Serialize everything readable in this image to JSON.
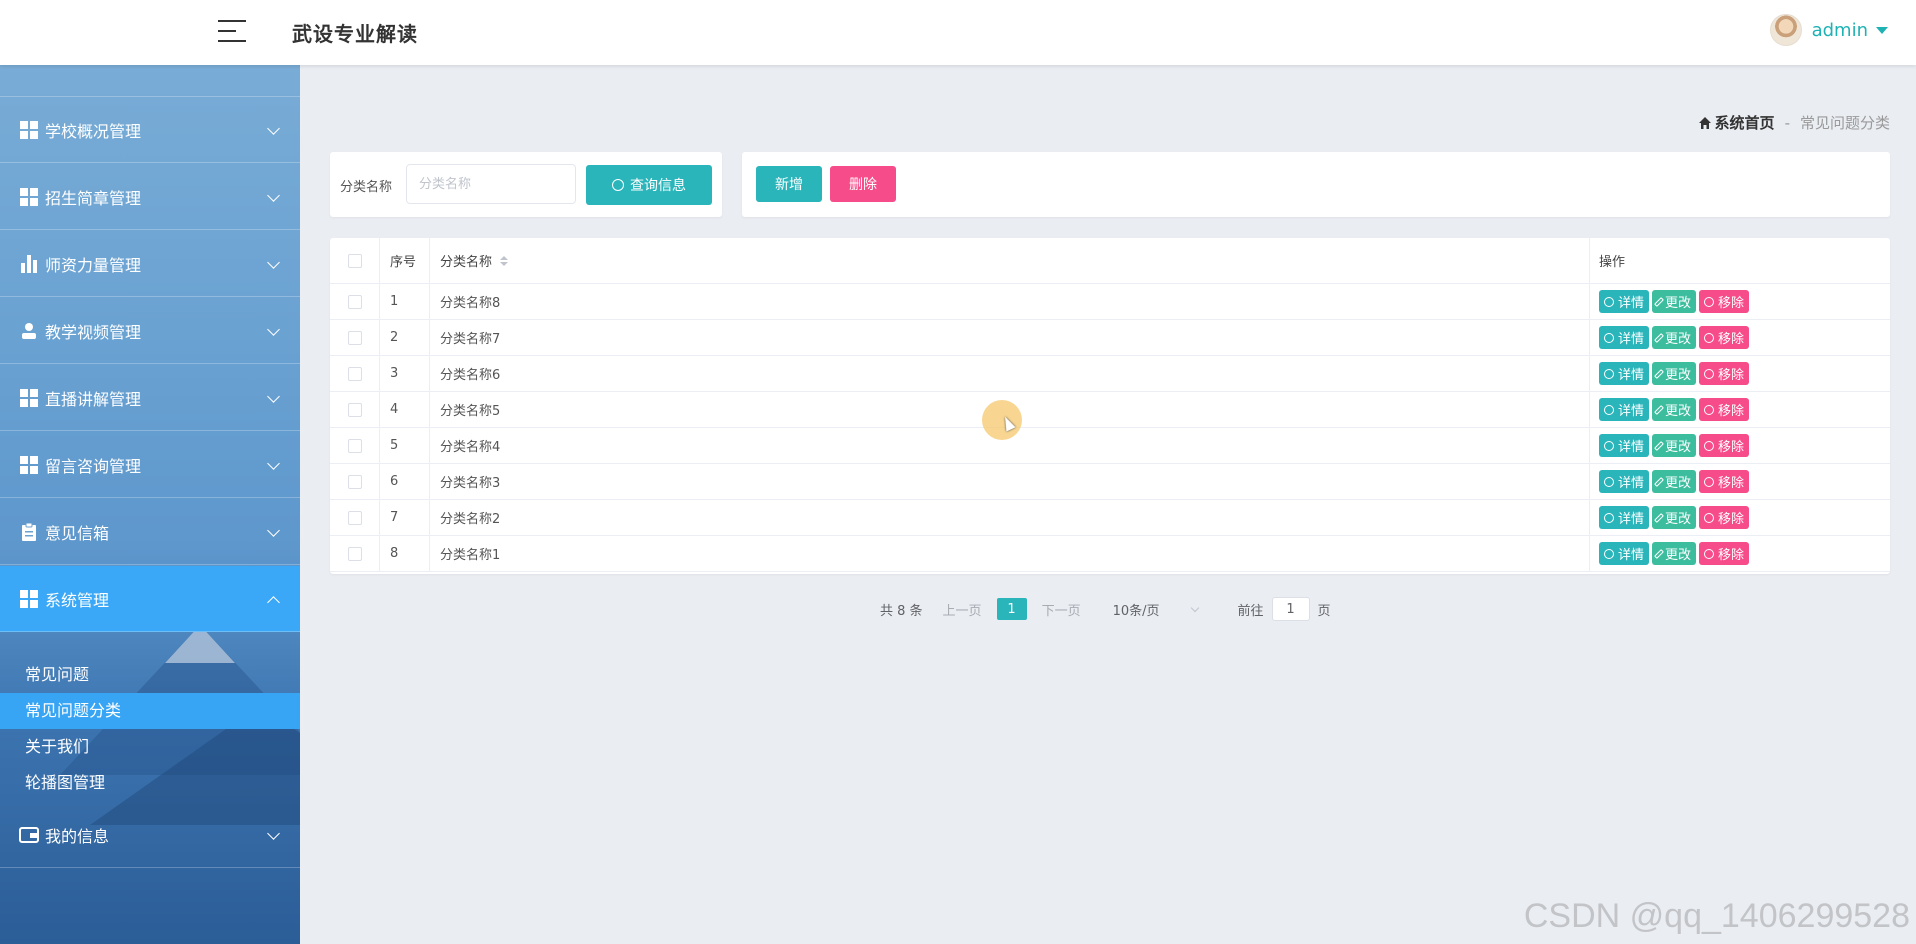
{
  "header": {
    "app_title": "武设专业解读",
    "user_name": "admin",
    "menu_toggle_icon": "hamburger-icon",
    "avatar_icon": "avatar"
  },
  "sidebar": {
    "items": [
      {
        "label": "学校概况管理",
        "icon": "grid-icon"
      },
      {
        "label": "招生简章管理",
        "icon": "grid-icon"
      },
      {
        "label": "师资力量管理",
        "icon": "bar-chart-icon"
      },
      {
        "label": "教学视频管理",
        "icon": "user-icon"
      },
      {
        "label": "直播讲解管理",
        "icon": "grid-icon"
      },
      {
        "label": "留言咨询管理",
        "icon": "grid-icon"
      },
      {
        "label": "意见信箱",
        "icon": "clipboard-icon"
      },
      {
        "label": "系统管理",
        "icon": "grid-icon",
        "expanded": true
      },
      {
        "label": "我的信息",
        "icon": "wallet-icon"
      }
    ],
    "sub_items": [
      "常见问题",
      "常见问题分类",
      "关于我们",
      "轮播图管理"
    ],
    "active_sub_item": "常见问题分类",
    "active_color": "#3aa8f6"
  },
  "breadcrumb": {
    "home": "系统首页",
    "separator": "-",
    "current": "常见问题分类"
  },
  "search": {
    "label": "分类名称",
    "placeholder": "分类名称",
    "value": "",
    "button_label": "查询信息"
  },
  "toolbar": {
    "add_label": "新增",
    "delete_label": "删除"
  },
  "table": {
    "headers": [
      "序号",
      "分类名称",
      "操作"
    ],
    "rows": [
      {
        "index": "1",
        "name": "分类名称8"
      },
      {
        "index": "2",
        "name": "分类名称7"
      },
      {
        "index": "3",
        "name": "分类名称6"
      },
      {
        "index": "4",
        "name": "分类名称5"
      },
      {
        "index": "5",
        "name": "分类名称4"
      },
      {
        "index": "6",
        "name": "分类名称3"
      },
      {
        "index": "7",
        "name": "分类名称2"
      },
      {
        "index": "8",
        "name": "分类名称1"
      }
    ],
    "row_actions": {
      "detail": "详情",
      "edit": "更改",
      "remove": "移除"
    }
  },
  "pagination": {
    "total_text": "共 8 条",
    "prev": "上一页",
    "current_page": "1",
    "next": "下一页",
    "page_size": "10条/页",
    "goto_label": "前往",
    "goto_value": "1",
    "page_unit": "页"
  },
  "colors": {
    "accent": "#2ab5bb",
    "edit": "#3cbd9e",
    "danger": "#f74c8a",
    "sidebar_active": "#3aa8f6"
  },
  "watermark": "CSDN @qq_1406299528"
}
